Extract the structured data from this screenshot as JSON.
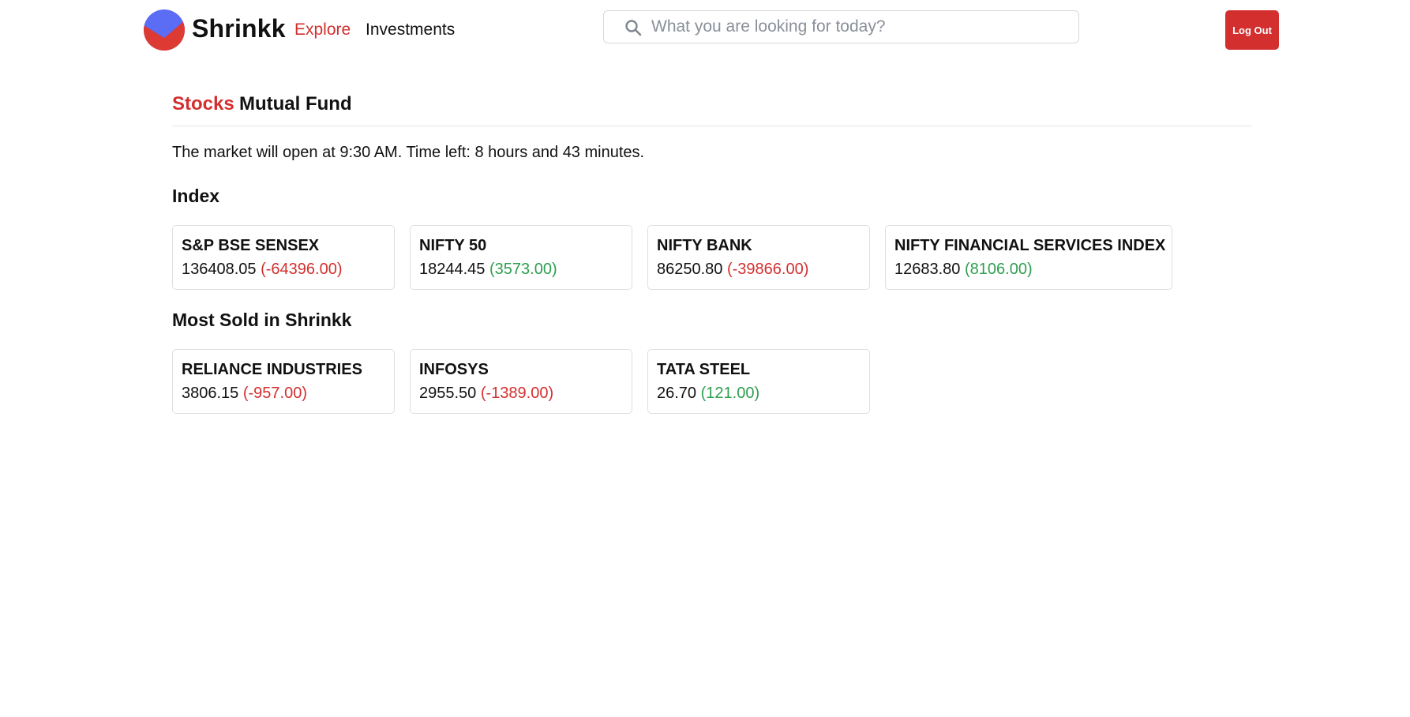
{
  "header": {
    "brand": "Shrinkk",
    "nav": {
      "explore": "Explore",
      "investments": "Investments"
    },
    "search": {
      "placeholder": "What you are looking for today?",
      "icon": "search-icon"
    },
    "logout_label": "Log Out"
  },
  "tabs": {
    "stocks": "Stocks",
    "mutual_fund": "Mutual Fund",
    "active": "Stocks"
  },
  "market_message": "The market will open at 9:30 AM. Time left: 8 hours and 43 minutes.",
  "index_section": {
    "title": "Index",
    "cards": [
      {
        "name": "S&P BSE SENSEX",
        "price": "136408.05",
        "change": "(-64396.00)",
        "trend": "negative"
      },
      {
        "name": "NIFTY 50",
        "price": "18244.45",
        "change": "(3573.00)",
        "trend": "positive"
      },
      {
        "name": "NIFTY BANK",
        "price": "86250.80",
        "change": "(-39866.00)",
        "trend": "negative"
      },
      {
        "name": "NIFTY FINANCIAL SERVICES INDEX",
        "price": "12683.80",
        "change": "(8106.00)",
        "trend": "positive"
      }
    ]
  },
  "most_sold_section": {
    "title": "Most Sold in Shrinkk",
    "cards": [
      {
        "name": "RELIANCE INDUSTRIES",
        "price": "3806.15",
        "change": "(-957.00)",
        "trend": "negative"
      },
      {
        "name": "INFOSYS",
        "price": "2955.50",
        "change": "(-1389.00)",
        "trend": "negative"
      },
      {
        "name": "TATA STEEL",
        "price": "26.70",
        "change": "(121.00)",
        "trend": "positive"
      }
    ]
  },
  "colors": {
    "accent": "#d32f2f",
    "positive": "#2e9e4f",
    "negative": "#d32f2f",
    "logo_blue": "#5b6cf5",
    "logo_red": "#dd3a34"
  }
}
